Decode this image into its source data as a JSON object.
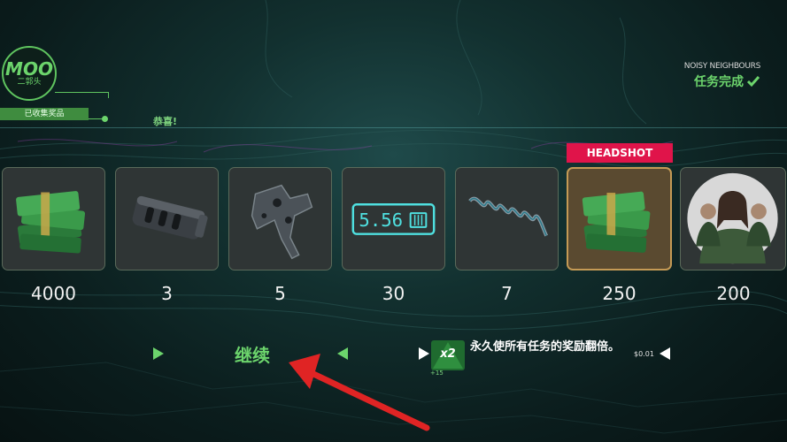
{
  "header": {
    "logo_big": "MOO",
    "logo_small": "二郭头",
    "collected_label": "已收集奖品",
    "congrats": "恭喜!"
  },
  "mission": {
    "name": "NOISY NEIGHBOURS",
    "status": "任务完成"
  },
  "rewards": [
    {
      "icon": "cash-stack-icon",
      "quantity": "4000",
      "tag": ""
    },
    {
      "icon": "muzzle-brake-icon",
      "quantity": "3",
      "tag": ""
    },
    {
      "icon": "trigger-assembly-icon",
      "quantity": "5",
      "tag": ""
    },
    {
      "icon": "ammo-counter-icon",
      "quantity": "30",
      "tag": "",
      "label": "5.56"
    },
    {
      "icon": "spring-icon",
      "quantity": "7",
      "tag": ""
    },
    {
      "icon": "cash-stack-icon",
      "quantity": "250",
      "tag": "HEADSHOT"
    },
    {
      "icon": "survivors-portrait-icon",
      "quantity": "200",
      "tag": ""
    }
  ],
  "actions": {
    "continue_label": "继续"
  },
  "bonus": {
    "badge": "x2",
    "badge_sub": "+15",
    "text": "永久使所有任务的奖励翻倍。",
    "price": "$0.01"
  },
  "colors": {
    "accent_green": "#6cd46c",
    "headshot_red": "#e0144a",
    "card_bg": "#2f3535",
    "gold_border": "#c49a55"
  }
}
